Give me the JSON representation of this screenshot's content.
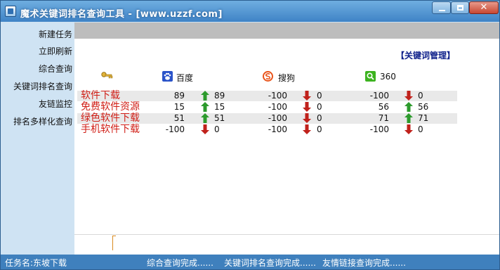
{
  "window": {
    "title": "魔术关键词排名查询工具 - [www.uzzf.com]",
    "controls": {
      "minimize": "minimize",
      "maximize": "maximize",
      "close": "✕"
    }
  },
  "sidebar": {
    "items": [
      {
        "label": "新建任务"
      },
      {
        "label": "立即刷新"
      },
      {
        "label": "综合查询"
      },
      {
        "label": "关键词排名查询"
      },
      {
        "label": "友链监控"
      },
      {
        "label": "排名多样化查询"
      }
    ]
  },
  "main": {
    "keyword_manage_link": "【关键词管理】",
    "key_icon": "key-icon",
    "engines": [
      {
        "name": "百度",
        "icon": "baidu-paw-icon"
      },
      {
        "name": "搜狗",
        "icon": "sogou-s-icon"
      },
      {
        "name": "360",
        "icon": "360-search-icon"
      }
    ],
    "rows": [
      {
        "keyword": "软件下载",
        "baidu": {
          "value": "89",
          "trend": "up",
          "change": "89"
        },
        "sogou": {
          "value": "-100",
          "trend": "down",
          "change": "0"
        },
        "e360": {
          "value": "-100",
          "trend": "down",
          "change": "0"
        }
      },
      {
        "keyword": "免费软件资源",
        "baidu": {
          "value": "15",
          "trend": "up",
          "change": "15"
        },
        "sogou": {
          "value": "-100",
          "trend": "down",
          "change": "0"
        },
        "e360": {
          "value": "56",
          "trend": "up",
          "change": "56"
        }
      },
      {
        "keyword": "绿色软件下载",
        "baidu": {
          "value": "51",
          "trend": "up",
          "change": "51"
        },
        "sogou": {
          "value": "-100",
          "trend": "down",
          "change": "0"
        },
        "e360": {
          "value": "71",
          "trend": "up",
          "change": "71"
        }
      },
      {
        "keyword": "手机软件下载",
        "baidu": {
          "value": "-100",
          "trend": "down",
          "change": "0"
        },
        "sogou": {
          "value": "-100",
          "trend": "down",
          "change": "0"
        },
        "e360": {
          "value": "-100",
          "trend": "down",
          "change": "0"
        }
      }
    ],
    "colors": {
      "keyword": "#d01e16",
      "up_arrow": "#2c9a2c",
      "down_arrow": "#c0211b",
      "link": "#0d1f8a"
    }
  },
  "statusbar": {
    "task": "任务名:东坡下载",
    "msg1": "综合查询完成......",
    "msg2": "关键词排名查询完成......",
    "msg3": "友情链接查询完成......"
  }
}
